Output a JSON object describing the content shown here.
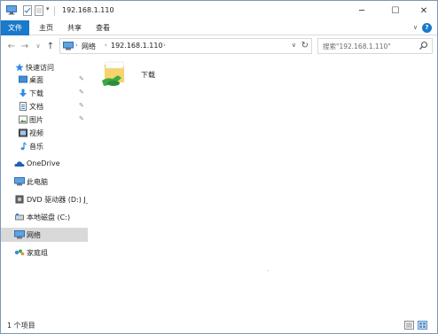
{
  "window": {
    "title": "192.168.1.110",
    "controls": {
      "minimize": "─",
      "maximize": "☐",
      "close": "✕"
    }
  },
  "ribbon": {
    "tabs": [
      "文件",
      "主页",
      "共享",
      "查看"
    ],
    "expand_icon": "chevron-down-icon",
    "help_label": "?"
  },
  "nav": {
    "back": "←",
    "forward": "→",
    "recent": "∨",
    "up": "↑",
    "breadcrumb": [
      "网络",
      "192.168.1.110"
    ],
    "crumb_sep": "›",
    "address_dropdown": "∨",
    "refresh": "↻",
    "search_placeholder": "搜索\"192.168.1.110\""
  },
  "sidebar": {
    "items": [
      {
        "label": "快速访问",
        "icon": "star-icon",
        "pinned": false
      },
      {
        "label": "桌面",
        "icon": "desktop-icon",
        "pinned": true
      },
      {
        "label": "下载",
        "icon": "download-icon",
        "pinned": true
      },
      {
        "label": "文档",
        "icon": "document-icon",
        "pinned": true
      },
      {
        "label": "图片",
        "icon": "picture-icon",
        "pinned": true
      },
      {
        "label": "视频",
        "icon": "video-icon",
        "pinned": false
      },
      {
        "label": "音乐",
        "icon": "music-icon",
        "pinned": false
      },
      {
        "label": "OneDrive",
        "icon": "cloud-icon",
        "pinned": false
      },
      {
        "label": "此电脑",
        "icon": "computer-icon",
        "pinned": false
      },
      {
        "label": "DVD 驱动器 (D:) J_C",
        "icon": "dvd-icon",
        "pinned": false
      },
      {
        "label": "本地磁盘 (C:)",
        "icon": "drive-icon",
        "pinned": false
      },
      {
        "label": "网络",
        "icon": "network-icon",
        "pinned": false,
        "selected": true
      },
      {
        "label": "家庭组",
        "icon": "homegroup-icon",
        "pinned": false
      }
    ],
    "pin_glyph": "📌"
  },
  "content": {
    "items": [
      {
        "name": "下载",
        "icon": "shared-folder-icon"
      }
    ]
  },
  "status": {
    "count": "1 个项目"
  },
  "colors": {
    "accent": "#1979ca",
    "selected": "#d9d9d9",
    "folder": "#f2c94c",
    "share_green": "#3aa845"
  }
}
